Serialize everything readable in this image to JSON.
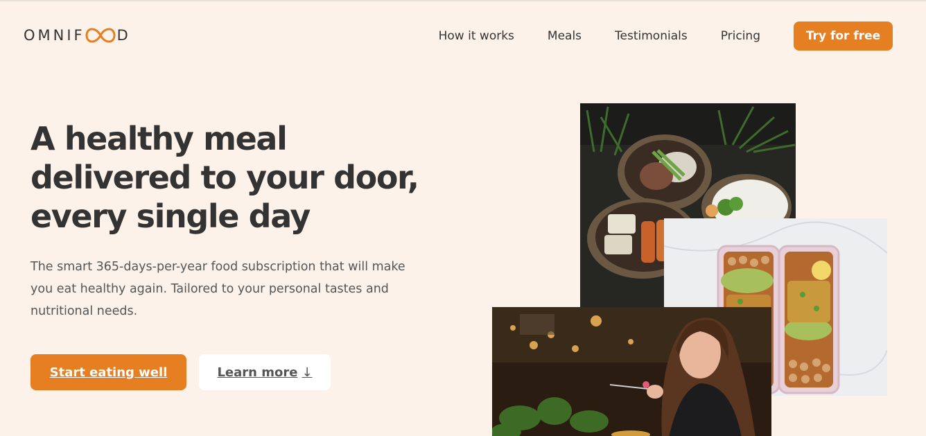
{
  "brand": {
    "logo_prefix": "OMNIF",
    "logo_suffix": "D",
    "accent_color": "#e67e22",
    "background_color": "#fdf2e9"
  },
  "nav": {
    "items": [
      {
        "label": "How it works"
      },
      {
        "label": "Meals"
      },
      {
        "label": "Testimonials"
      },
      {
        "label": "Pricing"
      }
    ],
    "cta_label": "Try for free"
  },
  "hero": {
    "title_lines": [
      "A healthy meal",
      "delivered to your door,",
      "every single day"
    ],
    "description": "The smart 365-days-per-year food subscription that will make you eat healthy again. Tailored to your personal tastes and nutritional needs.",
    "primary_button": "Start eating well",
    "secondary_button": "Learn more",
    "secondary_icon": "↓"
  },
  "images": {
    "bowls": "food-bowls-photo",
    "boxes": "meal-prep-boxes-photo",
    "woman": "woman-eating-photo"
  }
}
